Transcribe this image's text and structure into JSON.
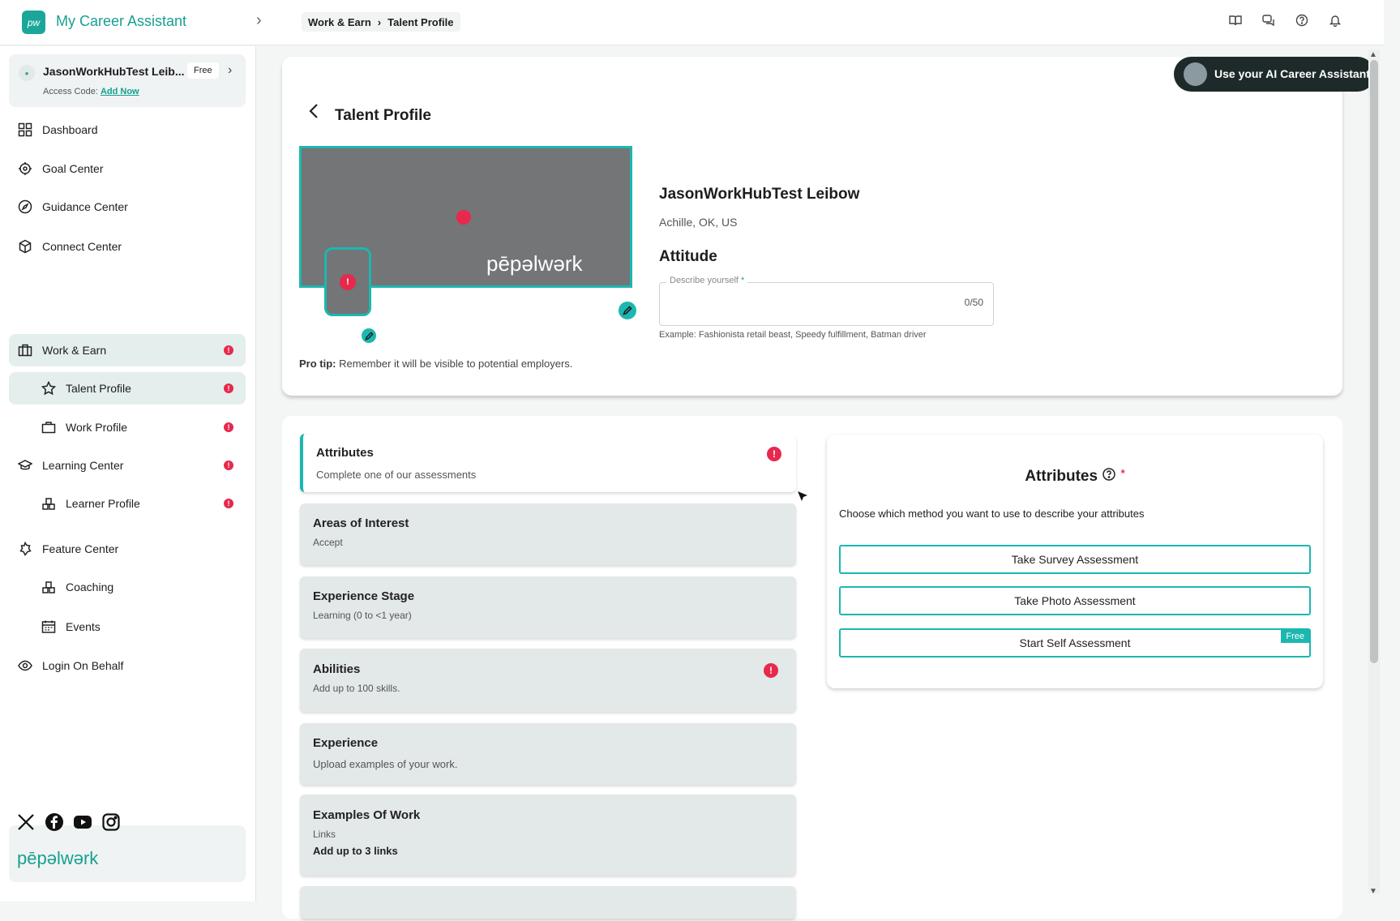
{
  "app": {
    "title": "My Career Assistant",
    "logo_text": "pw"
  },
  "breadcrumb": [
    "Work & Earn",
    "Talent Profile"
  ],
  "account": {
    "name": "JasonWorkHubTest Leib...",
    "badge": "Free",
    "access_label": "Access Code:",
    "access_link": "Add Now"
  },
  "nav": {
    "dashboard": "Dashboard",
    "goal": "Goal Center",
    "guidance": "Guidance Center",
    "connect": "Connect Center",
    "work": "Work & Earn",
    "talent": "Talent Profile",
    "workprofile": "Work Profile",
    "learning": "Learning Center",
    "learner": "Learner Profile",
    "feature": "Feature Center",
    "coaching": "Coaching",
    "events": "Events",
    "login": "Login On Behalf"
  },
  "brand": "pēpəlwərk",
  "assistant_button": "Use your AI Career Assistant",
  "profile": {
    "page_title": "Talent Profile",
    "name": "JasonWorkHubTest Leibow",
    "location": "Achille, OK, US",
    "attitude_heading": "Attitude",
    "field_label": "Describe yourself",
    "field_required": "*",
    "field_count": "0/50",
    "field_example": "Example: Fashionista retail beast, Speedy fulfillment, Batman driver",
    "protip_label": "Pro tip:",
    "protip_text": " Remember it will be visible to potential employers.",
    "cover_brand": "pēpəlwərk"
  },
  "sections": [
    {
      "title": "Attributes",
      "sub": "Complete one of our assessments"
    },
    {
      "title": "Areas of Interest",
      "sub": "Accept"
    },
    {
      "title": "Experience Stage",
      "sub": "Learning (0 to <1 year)"
    },
    {
      "title": "Abilities",
      "sub": "Add up to 100 skills."
    },
    {
      "title": "Experience",
      "sub": "Upload examples of your work."
    },
    {
      "title": "Examples Of Work",
      "sub": "Links",
      "sub2": "Add up to 3 links"
    }
  ],
  "attributes_panel": {
    "title": "Attributes",
    "required": "*",
    "desc": "Choose which method you want to use to describe your attributes",
    "btn_survey": "Take Survey Assessment",
    "btn_photo": "Take Photo Assessment",
    "btn_self": "Start Self Assessment",
    "free_tag": "Free"
  },
  "alert_mark": "!",
  "colors": {
    "accent": "#1cb7b0",
    "brand": "#17a092",
    "alert": "#e8284d"
  }
}
